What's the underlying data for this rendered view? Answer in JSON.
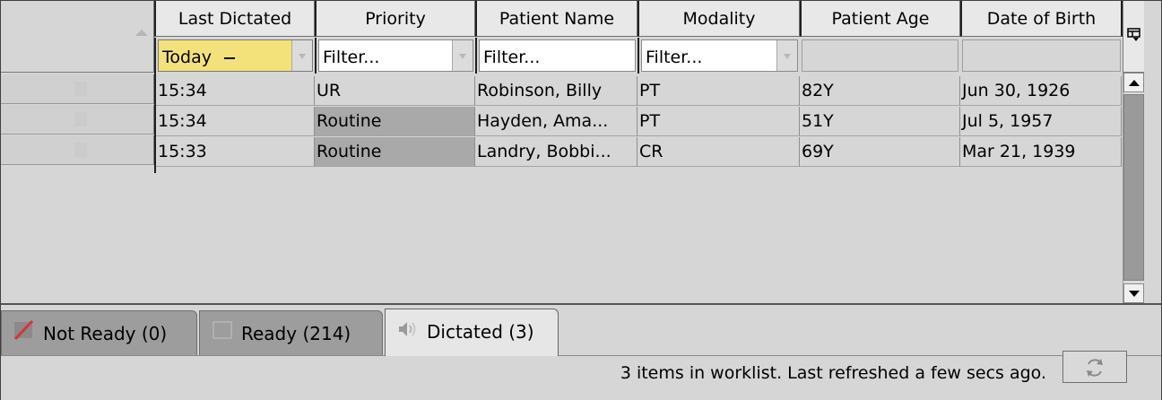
{
  "columns": [
    {
      "label": "Last Dictated"
    },
    {
      "label": "Priority"
    },
    {
      "label": "Patient Name"
    },
    {
      "label": "Modality"
    },
    {
      "label": "Patient Age"
    },
    {
      "label": "Date of Birth"
    }
  ],
  "filters": {
    "last_dictated": "Today",
    "priority": "Filter...",
    "patient_name": "Filter...",
    "modality": "Filter..."
  },
  "rows": [
    {
      "last_dictated": "15:34",
      "priority": "UR",
      "patient_name": "Robinson, Billy",
      "modality": "PT",
      "age": "82Y",
      "dob": "Jun 30, 1926"
    },
    {
      "last_dictated": "15:34",
      "priority": "Routine",
      "patient_name": "Hayden, Ama...",
      "modality": "PT",
      "age": "51Y",
      "dob": "Jul 5, 1957"
    },
    {
      "last_dictated": "15:33",
      "priority": "Routine",
      "patient_name": "Landry, Bobbi...",
      "modality": "CR",
      "age": "69Y",
      "dob": "Mar 21, 1939"
    }
  ],
  "tabs": [
    {
      "label": "Not Ready (0)",
      "icon": "not-ready-icon"
    },
    {
      "label": "Ready (214)",
      "icon": "ready-icon"
    },
    {
      "label": "Dictated (3)",
      "icon": "speaker-icon",
      "active": true
    }
  ],
  "status": {
    "message": "3 items in worklist.  Last refreshed a few secs ago."
  },
  "colors": {
    "today_filter": "#f3e27a",
    "routine_highlight": "#a9a9a9",
    "not_ready_slash": "#e03030"
  }
}
